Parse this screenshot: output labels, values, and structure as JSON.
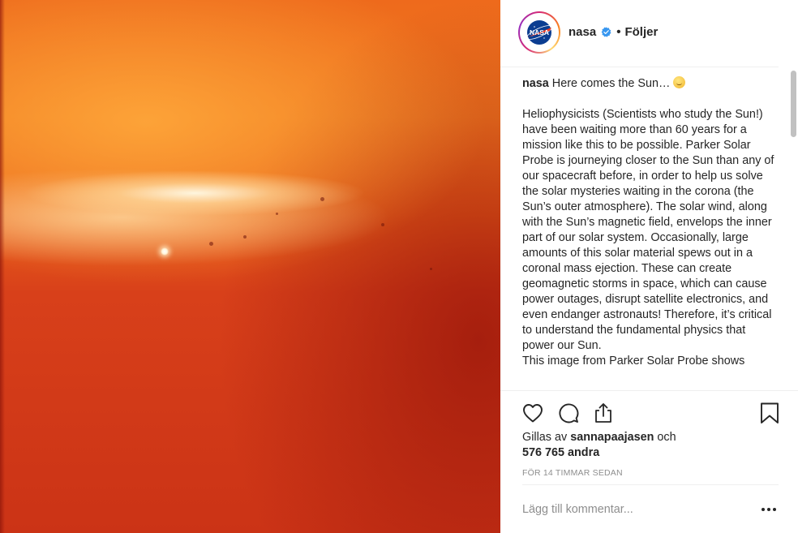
{
  "post": {
    "image_alt": "Parker Solar Probe WISPR image of the solar corona with the solar wind streaming and a bright planet"
  },
  "header": {
    "username": "nasa",
    "verified": true,
    "separator": "•",
    "follow_status": "Följer",
    "avatar_logo_text": "NASA"
  },
  "caption": {
    "username": "nasa",
    "first_line": " Here comes the Sun…",
    "emoji": "smiling-sun-emoji",
    "body": "Heliophysicists (Scientists who study the Sun!) have been waiting more than 60 years for a mission like this to be possible. Parker Solar Probe is journeying closer to the Sun than any of our spacecraft before, in order to help us solve the solar mysteries waiting in the corona (the Sun’s outer atmosphere). The solar wind, along with the Sun’s magnetic field, envelops the inner part of our solar system. Occasionally, large amounts of this solar material spews out in a coronal mass ejection. These can create geomagnetic storms in space, which can cause power outages, disrupt satellite electronics, and even endanger astronauts! Therefore, it’s critical to understand the fundamental physics that power our Sun.\nThis image from Parker Solar Probe shows"
  },
  "actions": {
    "icons": [
      "heart-icon",
      "comment-icon",
      "share-icon",
      "bookmark-icon"
    ]
  },
  "likes": {
    "prefix": "Gillas av ",
    "user": "sannapaajasen",
    "middle": " och",
    "count": "576 765 andra"
  },
  "timestamp": "FÖR 14 TIMMAR SEDAN",
  "comment": {
    "placeholder": "Lägg till kommentar...",
    "more_label": "..."
  },
  "colors": {
    "verified_blue": "#3897f0",
    "text": "#262626",
    "muted": "#8e8e8e",
    "divider": "#efefef"
  }
}
